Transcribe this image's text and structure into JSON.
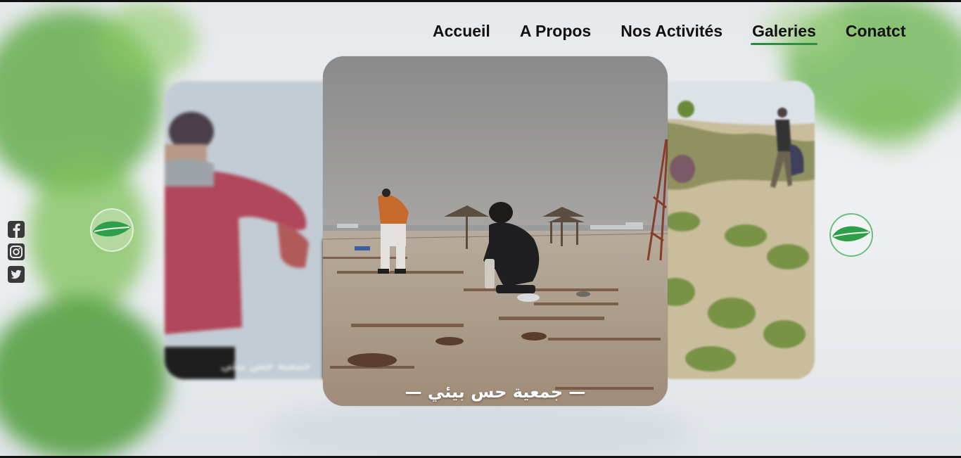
{
  "nav": {
    "items": [
      {
        "label": "Accueil",
        "active": false
      },
      {
        "label": "A Propos",
        "active": false
      },
      {
        "label": "Nos Activités",
        "active": false
      },
      {
        "label": "Galeries",
        "active": true
      },
      {
        "label": "Conatct",
        "active": false
      }
    ]
  },
  "social": {
    "icons": [
      "facebook-icon",
      "instagram-icon",
      "twitter-icon"
    ],
    "color": "#3a3a3a"
  },
  "gallery": {
    "center_caption": "— جمعية حس بيئي —",
    "left_caption": "جمعية حس بيئي",
    "prev_icon": "leaf-icon",
    "next_icon": "leaf-icon",
    "accent_color": "#2e8b43"
  }
}
